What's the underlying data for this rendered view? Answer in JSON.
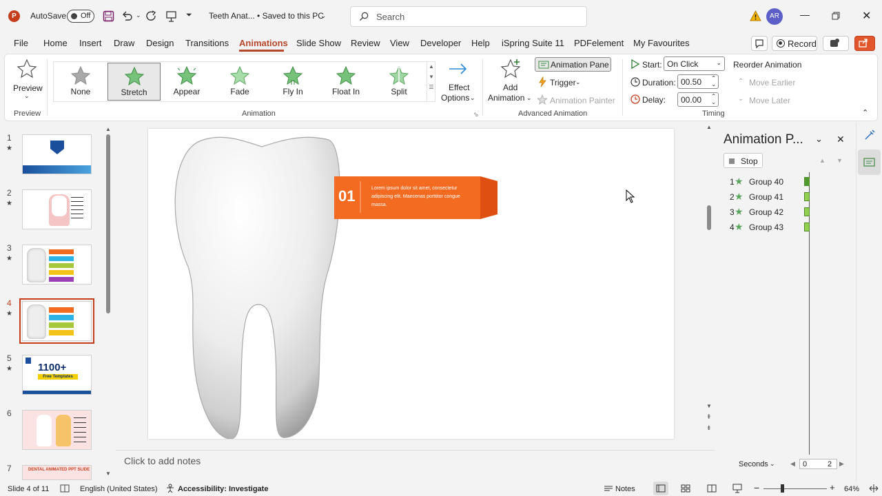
{
  "titlebar": {
    "autosave_label": "AutoSave",
    "autosave_state": "Off",
    "doc_title": "Teeth Anat...  •  Saved to this PC",
    "search_placeholder": "Search",
    "user_initials": "AR"
  },
  "tabs": [
    "File",
    "Home",
    "Insert",
    "Draw",
    "Design",
    "Transitions",
    "Animations",
    "Slide Show",
    "Review",
    "View",
    "Developer",
    "Help",
    "iSpring Suite 11",
    "PDFelement",
    "My Favourites"
  ],
  "active_tab": "Animations",
  "record_label": "Record",
  "ribbon": {
    "preview": {
      "button": "Preview",
      "group": "Preview"
    },
    "animation": {
      "group": "Animation",
      "items": [
        "None",
        "Stretch",
        "Appear",
        "Fade",
        "Fly In",
        "Float In",
        "Split"
      ],
      "selected": "Stretch",
      "effect_options": [
        "Effect",
        "Options"
      ]
    },
    "advanced": {
      "group": "Advanced Animation",
      "add_animation": [
        "Add",
        "Animation"
      ],
      "animation_pane": "Animation Pane",
      "trigger": "Trigger",
      "animation_painter": "Animation Painter"
    },
    "timing": {
      "group": "Timing",
      "start_label": "Start:",
      "start_value": "On Click",
      "duration_label": "Duration:",
      "duration_value": "00.50",
      "delay_label": "Delay:",
      "delay_value": "00.00",
      "reorder": "Reorder Animation",
      "move_earlier": "Move Earlier",
      "move_later": "Move Later"
    }
  },
  "slides": [
    {
      "num": "1"
    },
    {
      "num": "2"
    },
    {
      "num": "3"
    },
    {
      "num": "4"
    },
    {
      "num": "5",
      "text": "1100+",
      "subtext": "Free Templates"
    },
    {
      "num": "6"
    },
    {
      "num": "7",
      "text": "DENTAL ANIMATED PPT SLIDE"
    }
  ],
  "selected_slide": "4",
  "slide_content": {
    "label_number": "01",
    "label_text": "Lorem ipsum dolor sit amet, consectetur adipiscing elit. Maecenas porttitor congue massa."
  },
  "notes_placeholder": "Click to add notes",
  "animation_pane": {
    "title": "Animation P...",
    "stop_label": "Stop",
    "items": [
      {
        "num": "1",
        "name": "Group 40"
      },
      {
        "num": "2",
        "name": "Group 41"
      },
      {
        "num": "3",
        "name": "Group 42"
      },
      {
        "num": "4",
        "name": "Group 43"
      }
    ],
    "seconds_label": "Seconds",
    "timeline": [
      "0",
      "2"
    ]
  },
  "status": {
    "slide_info": "Slide 4 of 11",
    "language": "English (United States)",
    "accessibility": "Accessibility: Investigate",
    "notes": "Notes",
    "zoom": "64%"
  },
  "colors": {
    "accent": "#b7472a",
    "label_orange": "#f26b21",
    "anim_star": "#77c27a"
  }
}
